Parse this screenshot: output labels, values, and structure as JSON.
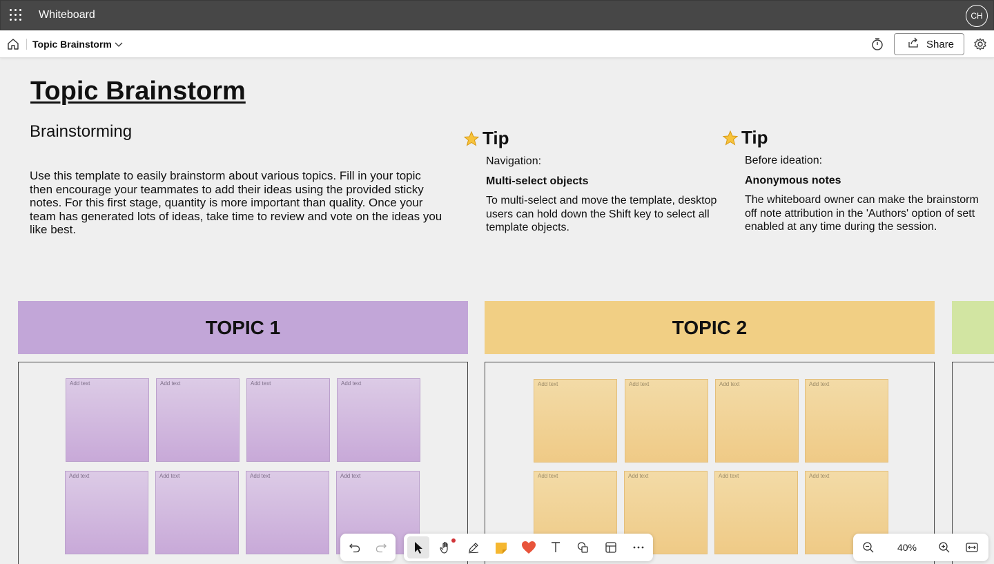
{
  "app": {
    "title": "Whiteboard",
    "avatar_initials": "CH"
  },
  "command_bar": {
    "board_name": "Topic Brainstorm",
    "share_label": "Share"
  },
  "canvas": {
    "title": "Topic Brainstorm",
    "subtitle": "Brainstorming",
    "description": "Use this template to easily brainstorm about various topics. Fill in your topic then encourage your teammates to add their ideas using the provided sticky notes. For this first stage, quantity is more important than quality. Once your team has generated lots of ideas, take time to review and vote on the ideas you like best.",
    "tips": [
      {
        "heading": "Tip",
        "line1": "Navigation:",
        "line2": "Multi-select objects",
        "line3": "To multi-select and move the template, desktop users can hold down the Shift key to select all template objects."
      },
      {
        "heading": "Tip",
        "line1": "Before ideation:",
        "line2": "Anonymous notes",
        "line3": "The whiteboard owner can make the brainstorm\noff note attribution in the 'Authors' option of sett\nenabled at any time during the session."
      }
    ],
    "topics": [
      {
        "label": "TOPIC 1",
        "color": "#c2a6d8"
      },
      {
        "label": "TOPIC 2",
        "color": "#f1cf84"
      },
      {
        "label": "",
        "color": "#d2e5a2"
      }
    ],
    "sticky_placeholder": "Add text"
  },
  "toolbar": {
    "zoom_level": "40%",
    "tools": [
      "select-icon",
      "hand-pan-icon",
      "pen-icon",
      "sticky-note-icon",
      "reaction-heart-icon",
      "text-icon",
      "shapes-icon",
      "templates-icon",
      "more-icon"
    ]
  }
}
